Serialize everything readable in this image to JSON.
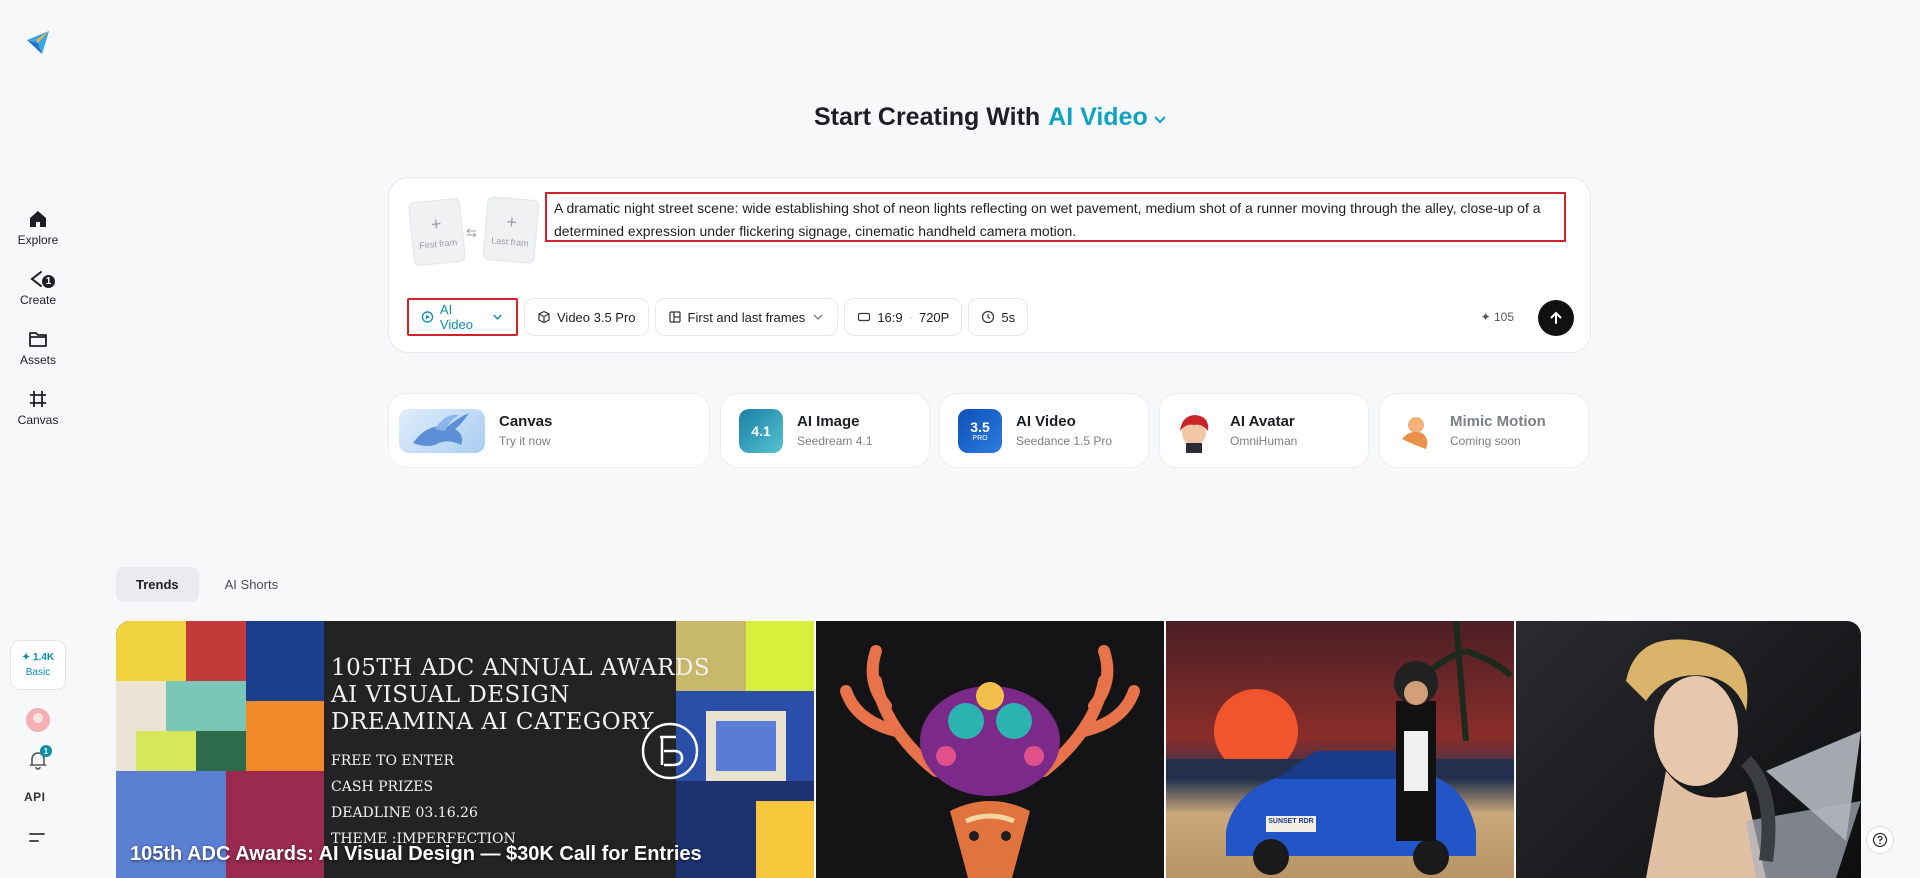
{
  "sidebar": {
    "items": [
      {
        "label": "Explore",
        "icon": "home-icon"
      },
      {
        "label": "Create",
        "icon": "create-icon",
        "badge": "1"
      },
      {
        "label": "Assets",
        "icon": "folder-icon"
      },
      {
        "label": "Canvas",
        "icon": "canvas-icon"
      }
    ],
    "credits": "1.4K",
    "plan": "Basic",
    "notification_count": "1",
    "api_label": "API"
  },
  "heading": {
    "prefix": "Start Creating With",
    "accent": "AI Video"
  },
  "prompt": {
    "first_frame_label": "First fram",
    "last_frame_label": "Last fram",
    "text": "A dramatic night street scene: wide establishing shot of neon lights reflecting on wet pavement, medium shot of a runner moving through the alley, close-up of a determined expression under flickering signage, cinematic handheld camera motion.",
    "toolbar": {
      "mode": "AI Video",
      "model": "Video 3.5 Pro",
      "frames": "First and last frames",
      "ratio": "16:9",
      "resolution": "720P",
      "duration": "5s"
    },
    "cost": "105"
  },
  "cards": [
    {
      "title": "Canvas",
      "sub": "Try it now"
    },
    {
      "title": "AI Image",
      "sub": "Seedream 4.1",
      "thumb_text": "4.1"
    },
    {
      "title": "AI Video",
      "sub": "Seedance 1.5 Pro",
      "thumb_text": "3.5",
      "thumb_tag": "PRO"
    },
    {
      "title": "AI Avatar",
      "sub": "OmniHuman"
    },
    {
      "title": "Mimic Motion",
      "sub": "Coming soon"
    }
  ],
  "tabs": [
    "Trends",
    "AI Shorts"
  ],
  "gallery": {
    "featured_caption": "105th ADC Awards: AI Visual Design — $30K Call for Entries",
    "poster_lines": [
      "105TH ADC ANNUAL AWARDS",
      "AI VISUAL DESIGN",
      "DREAMINA AI CATEGORY"
    ],
    "poster_small_lines": [
      "FREE TO ENTER",
      "CASH PRIZES",
      "DEADLINE 03.16.26",
      "THEME :IMPERFECTION"
    ],
    "car_plate": "SUNSET RDR"
  },
  "colors": {
    "accent": "#10a3c0",
    "highlight_border": "#d1222b"
  }
}
